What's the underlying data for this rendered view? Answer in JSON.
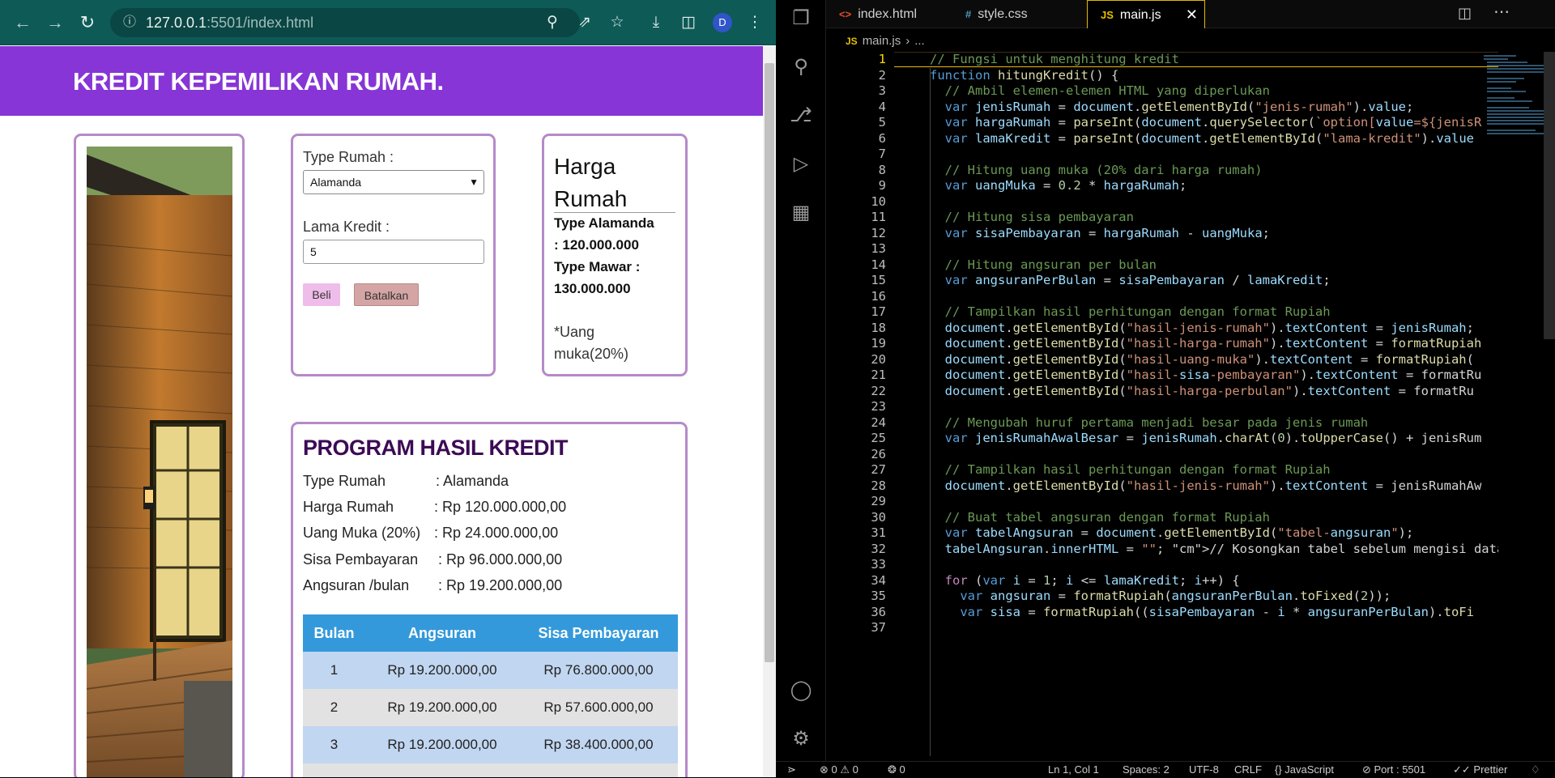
{
  "browser": {
    "url_host": "127.0.0.1",
    "url_rest": ":5501/index.html",
    "avatar_letter": "D"
  },
  "page": {
    "header_title": "KREDIT KEPEMILIKAN RUMAH.",
    "form": {
      "type_label": "Type Rumah :",
      "type_value": "Alamanda",
      "lama_label": "Lama Kredit :",
      "lama_value": "5",
      "beli_label": "Beli",
      "batal_label": "Batalkan"
    },
    "price": {
      "title_line1": "Harga",
      "title_line2": "Rumah",
      "line1": "Type Alamanda",
      "line2": ": 120.000.000",
      "line3": "Type Mawar :",
      "line4": "130.000.000",
      "note1": "*Uang",
      "note2": "muka(20%)"
    },
    "result": {
      "title": "PROGRAM HASIL KREDIT",
      "rows": [
        {
          "k": "Type Rumah",
          "v": ": Alamanda"
        },
        {
          "k": "Harga Rumah",
          "v": ": Rp 120.000.000,00"
        },
        {
          "k": "Uang Muka (20%)",
          "v": ": Rp 24.000.000,00"
        },
        {
          "k": "Sisa Pembayaran",
          "v": ": Rp 96.000.000,00"
        },
        {
          "k": "Angsuran /bulan",
          "v": ": Rp 19.200.000,00"
        }
      ],
      "table_headers": [
        "Bulan",
        "Angsuran",
        "Sisa Pembayaran"
      ],
      "table_rows": [
        [
          "1",
          "Rp 19.200.000,00",
          "Rp 76.800.000,00"
        ],
        [
          "2",
          "Rp 19.200.000,00",
          "Rp 57.600.000,00"
        ],
        [
          "3",
          "Rp 19.200.000,00",
          "Rp 38.400.000,00"
        ]
      ]
    }
  },
  "vscode": {
    "tabs": [
      {
        "icon": "<>",
        "label": "index.html"
      },
      {
        "icon": "#",
        "label": "style.css"
      },
      {
        "icon": "JS",
        "label": "main.js"
      }
    ],
    "breadcrumb_file": "main.js",
    "breadcrumb_rest": "...",
    "lines": [
      "// Fungsi untuk menghitung kredit",
      "function hitungKredit() {",
      "  // Ambil elemen-elemen HTML yang diperlukan",
      "  var jenisRumah = document.getElementById(\"jenis-rumah\").value;",
      "  var hargaRumah = parseInt(document.querySelector(`option[value=${jenisR",
      "  var lamaKredit = parseInt(document.getElementById(\"lama-kredit\").value",
      "",
      "  // Hitung uang muka (20% dari harga rumah)",
      "  var uangMuka = 0.2 * hargaRumah;",
      "",
      "  // Hitung sisa pembayaran",
      "  var sisaPembayaran = hargaRumah - uangMuka;",
      "",
      "  // Hitung angsuran per bulan",
      "  var angsuranPerBulan = sisaPembayaran / lamaKredit;",
      "",
      "  // Tampilkan hasil perhitungan dengan format Rupiah",
      "  document.getElementById(\"hasil-jenis-rumah\").textContent = jenisRumah;",
      "  document.getElementById(\"hasil-harga-rumah\").textContent = formatRupiah",
      "  document.getElementById(\"hasil-uang-muka\").textContent = formatRupiah(",
      "  document.getElementById(\"hasil-sisa-pembayaran\").textContent = formatRu",
      "  document.getElementById(\"hasil-harga-perbulan\").textContent = formatRu",
      "",
      "  // Mengubah huruf pertama menjadi besar pada jenis rumah",
      "  var jenisRumahAwalBesar = jenisRumah.charAt(0).toUpperCase() + jenisRum",
      "",
      "  // Tampilkan hasil perhitungan dengan format Rupiah",
      "  document.getElementById(\"hasil-jenis-rumah\").textContent = jenisRumahAw",
      "",
      "  // Buat tabel angsuran dengan format Rupiah",
      "  var tabelAngsuran = document.getElementById(\"tabel-angsuran\");",
      "  tabelAngsuran.innerHTML = \"\"; // Kosongkan tabel sebelum mengisi data",
      "",
      "  for (var i = 1; i <= lamaKredit; i++) {",
      "    var angsuran = formatRupiah(angsuranPerBulan.toFixed(2));",
      "    var sisa = formatRupiah((sisaPembayaran - i * angsuranPerBulan).toFi"
    ],
    "last_line_number": "37",
    "status": {
      "errors": "0",
      "warnings": "0",
      "ports": "0",
      "position": "Ln 1, Col 1",
      "spaces": "Spaces: 2",
      "encoding": "UTF-8",
      "eol": "CRLF",
      "language": "JavaScript",
      "port": "Port : 5501",
      "prettier": "Prettier"
    }
  }
}
